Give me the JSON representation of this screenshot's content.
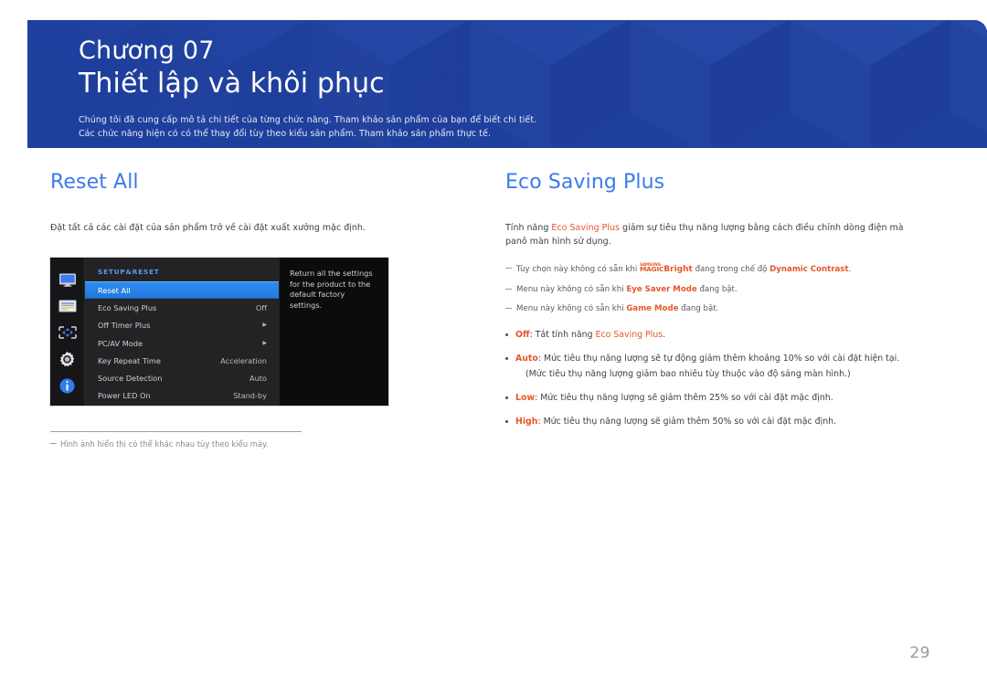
{
  "banner": {
    "chapter_label": "Chương 07",
    "chapter_title": "Thiết lập và khôi phục",
    "desc_line1": "Chúng tôi đã cung cấp mô tả chi tiết của từng chức năng. Tham khảo sản phẩm của bạn để biết chi tiết.",
    "desc_line2": "Các chức năng hiện có có thể thay đổi tùy theo kiểu sản phẩm. Tham khảo sản phẩm thực tế.",
    "bg_color": "#1f3f9e"
  },
  "left_column": {
    "title": "Reset All",
    "title_color": "#3a7bef",
    "lead": "Đặt tất cả các cài đặt của sản phẩm trở về cài đặt xuất xưởng mặc định.",
    "osd": {
      "heading": "SETUP&RESET",
      "heading_color": "#5d9bf2",
      "icons": [
        "monitor-icon",
        "color-bars-icon",
        "position-arrows-icon",
        "gear-icon",
        "info-icon"
      ],
      "rows": [
        {
          "label": "Reset All",
          "value": "",
          "arrow": false,
          "selected": true
        },
        {
          "label": "Eco Saving Plus",
          "value": "Off",
          "arrow": false,
          "selected": false
        },
        {
          "label": "Off Timer Plus",
          "value": "",
          "arrow": true,
          "selected": false
        },
        {
          "label": "PC/AV Mode",
          "value": "",
          "arrow": true,
          "selected": false
        },
        {
          "label": "Key Repeat Time",
          "value": "Acceleration",
          "arrow": false,
          "selected": false
        },
        {
          "label": "Source Detection",
          "value": "Auto",
          "arrow": false,
          "selected": false
        },
        {
          "label": "Power LED On",
          "value": "Stand-by",
          "arrow": false,
          "selected": false
        }
      ],
      "help_text": "Return all the settings for the product to the default factory settings."
    },
    "note": "Hình ảnh hiển thị có thể khác nhau tùy theo kiểu máy."
  },
  "right_column": {
    "title": "Eco Saving Plus",
    "title_color": "#3a7bef",
    "lead_part1": "Tính năng ",
    "lead_highlight": "Eco Saving Plus",
    "lead_part2": " giảm sự tiêu thụ năng lượng bằng cách điều chỉnh dòng điện mà panô màn hình sử dụng.",
    "notes": [
      {
        "pre": "Tùy chọn này không có sẵn khi ",
        "trademark_small": "SAMSUNG",
        "trademark_magic": "MAGIC",
        "trademark_bright": "Bright",
        "mid": " đang trong chế độ ",
        "highlight": "Dynamic Contrast",
        "post": "."
      },
      {
        "pre": "Menu này không có sẵn khi ",
        "highlight": "Eye Saver Mode",
        "post": " đang bật."
      },
      {
        "pre": "Menu này không có sẵn khi ",
        "highlight": "Game Mode",
        "post": " đang bật."
      }
    ],
    "bullets": [
      {
        "key": "Off",
        "text_pre": ": Tắt tính năng ",
        "inline_highlight": "Eco Saving Plus",
        "text_post": ".",
        "sub": ""
      },
      {
        "key": "Auto",
        "text_pre": ": Mức tiêu thụ năng lượng sẽ tự động giảm thêm khoảng 10% so với cài đặt hiện tại.",
        "inline_highlight": "",
        "text_post": "",
        "sub": "(Mức tiêu thụ năng lượng giảm bao nhiêu tùy thuộc vào độ sáng màn hình.)"
      },
      {
        "key": "Low",
        "text_pre": ": Mức tiêu thụ năng lượng sẽ giảm thêm 25% so với cài đặt mặc định.",
        "inline_highlight": "",
        "text_post": "",
        "sub": ""
      },
      {
        "key": "High",
        "text_pre": ": Mức tiêu thụ năng lượng sẽ giảm thêm 50% so với cài đặt mặc định.",
        "inline_highlight": "",
        "text_post": "",
        "sub": ""
      }
    ],
    "accent_color": "#e8562a"
  },
  "footer": {
    "page_number": "29"
  }
}
